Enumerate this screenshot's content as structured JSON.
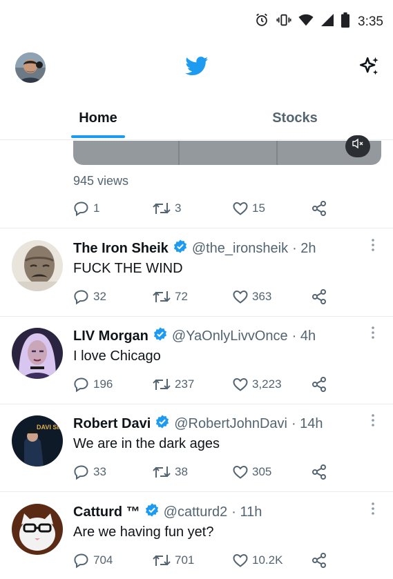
{
  "status_bar": {
    "time": "3:35",
    "icons": [
      "alarm-icon",
      "vibrate-icon",
      "wifi-icon",
      "signal-icon",
      "battery-icon"
    ]
  },
  "top_bar": {
    "logo": "twitter-bird-icon",
    "sparkle": "sparkle-icon"
  },
  "tabs": [
    {
      "label": "Home",
      "active": true
    },
    {
      "label": "Stocks",
      "active": false
    }
  ],
  "colors": {
    "accent": "#1d9bf0",
    "text": "#0f1419",
    "secondary": "#536471",
    "divider": "#e6ecf0"
  },
  "previous_tweet": {
    "views": "945 views",
    "reply_count": "1",
    "retweet_count": "3",
    "like_count": "15"
  },
  "tweets": [
    {
      "name": "The Iron Sheik",
      "handle": "@the_ironsheik",
      "time": "· 2h",
      "text": "FUCK THE WIND",
      "replies": "32",
      "retweets": "72",
      "likes": "363"
    },
    {
      "name": "LIV Morgan",
      "handle": "@YaOnlyLivvOnce",
      "time": "· 4h",
      "text": "I love Chicago",
      "replies": "196",
      "retweets": "237",
      "likes": "3,223"
    },
    {
      "name": "Robert Davi",
      "handle": "@RobertJohnDavi",
      "time": "· 14h",
      "text": "We are in the dark ages",
      "replies": "33",
      "retweets": "38",
      "likes": "305",
      "avatar_text": "DAVI SINGS SINATRA"
    },
    {
      "name": "Catturd ™",
      "handle": "@catturd2",
      "time": "· 11h",
      "text": "Are we having fun yet?",
      "replies": "704",
      "retweets": "701",
      "likes": "10.2K"
    }
  ]
}
